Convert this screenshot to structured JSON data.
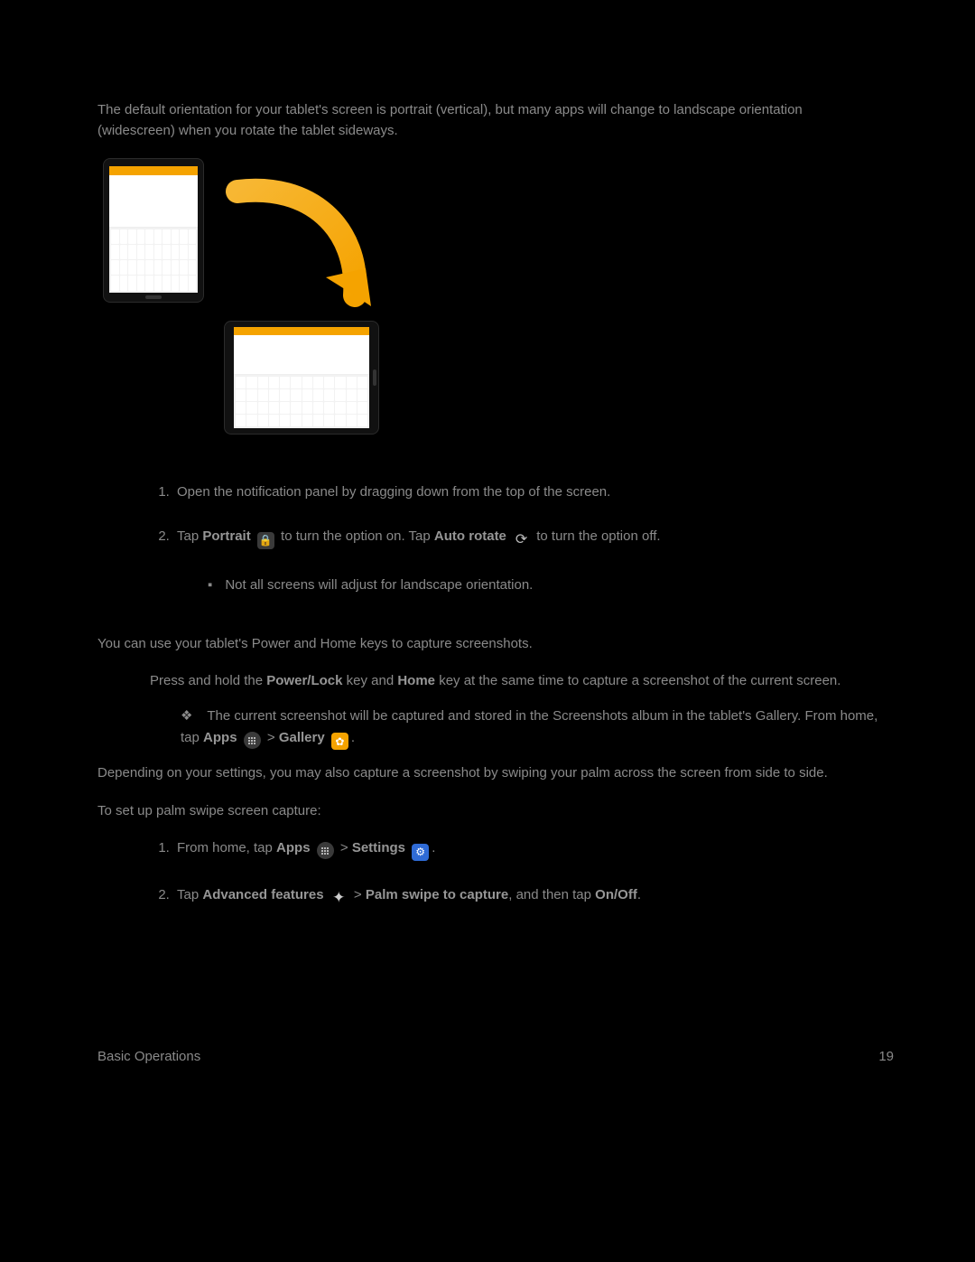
{
  "intro": "The default orientation for your tablet's screen is portrait (vertical), but many apps will change to landscape orientation (widescreen) when you rotate the tablet sideways.",
  "steps_a": {
    "s1": "Open the notification panel by dragging down from the top of the screen.",
    "s2_a": "Tap ",
    "s2_portrait": "Portrait",
    "s2_b": " to turn the option on. Tap ",
    "s2_autorotate": "Auto rotate",
    "s2_c": " to turn the option off.",
    "note": "Not all screens will adjust for landscape orientation."
  },
  "section2": {
    "intro": "You can use your tablet's Power and Home keys to capture screenshots.",
    "press_a": "Press and hold the ",
    "powerlock": "Power/Lock",
    "press_b": " key and ",
    "home": "Home",
    "press_c": " key at the same time to capture a screenshot of the current screen.",
    "stored_a": "The current screenshot will be captured and stored in the Screenshots album in the tablet's Gallery. From home, tap ",
    "apps": "Apps",
    "gt": " > ",
    "gallery": "Gallery",
    "period": ".",
    "palm": "Depending on your settings, you may also capture a screenshot by swiping your palm across the screen from side to side.",
    "setup": "To set up palm swipe screen capture:",
    "p1_a": "From home, tap ",
    "settings": "Settings",
    "p2_a": "Tap ",
    "adv": "Advanced features",
    "p2_b": " > ",
    "palmswipe": "Palm swipe to capture",
    "p2_c": ", and then tap ",
    "onoff": "On/Off",
    "p2_d": "."
  },
  "footer": {
    "left": "Basic Operations",
    "right": "19"
  }
}
